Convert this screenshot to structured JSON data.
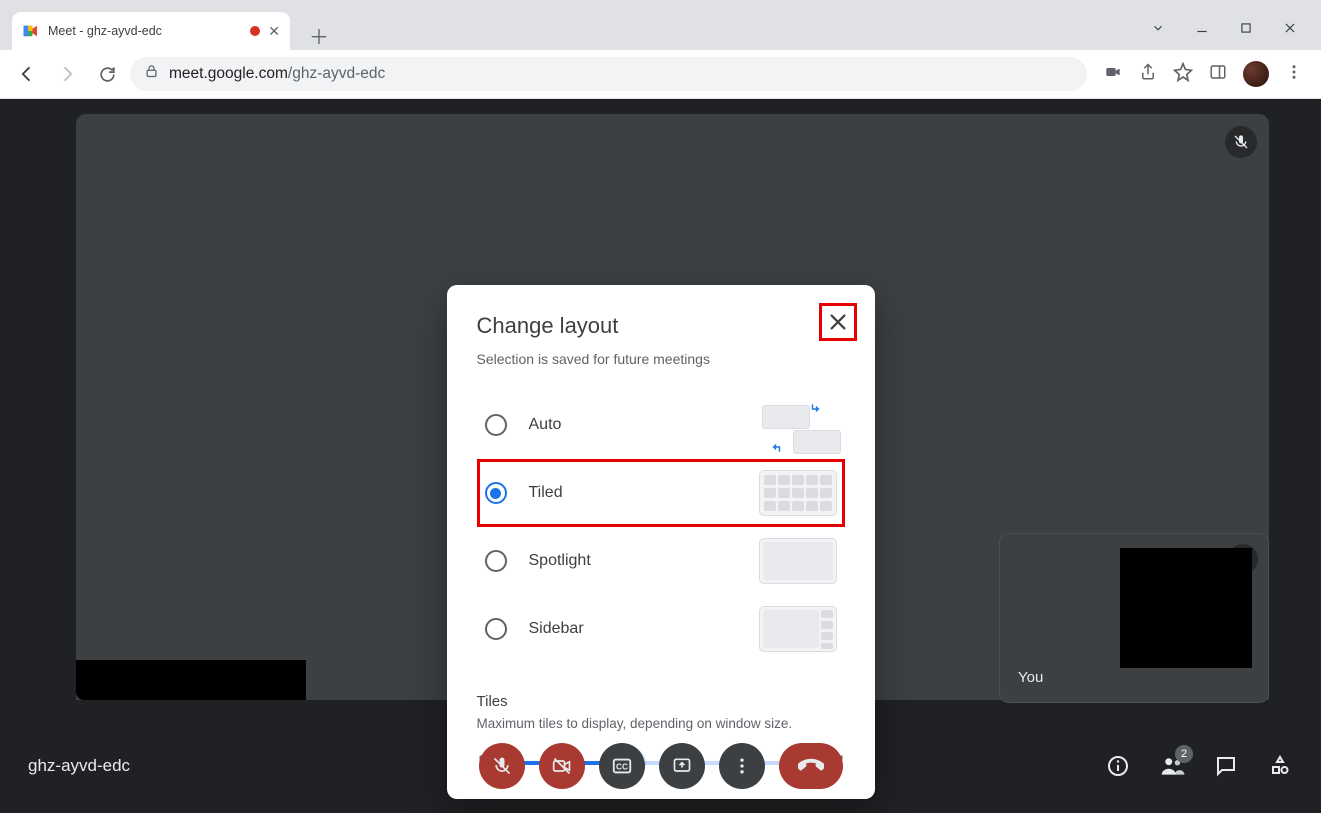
{
  "browser": {
    "tab_title": "Meet - ghz-ayvd-edc",
    "url_secure_host": "meet.google.com",
    "url_path": "/ghz-ayvd-edc"
  },
  "meet": {
    "meeting_code": "ghz-ayvd-edc",
    "self_label": "You",
    "participant_badge": "2"
  },
  "dialog": {
    "title": "Change layout",
    "subtitle": "Selection is saved for future meetings",
    "options": {
      "auto": "Auto",
      "tiled": "Tiled",
      "spotlight": "Spotlight",
      "sidebar": "Sidebar"
    },
    "selected": "tiled",
    "tiles_title": "Tiles",
    "tiles_subtitle": "Maximum tiles to display, depending on window size.",
    "slider_percent": 40
  }
}
